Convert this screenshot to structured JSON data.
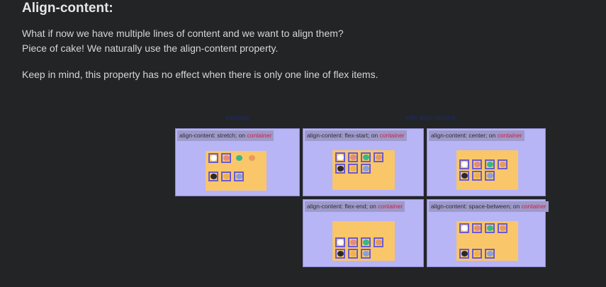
{
  "heading": "Align-content:",
  "intro_line1": "What if now we have multiple lines of content and we want to align them?",
  "intro_line2": "Piece of cake! We naturally use the align-content property.",
  "note": "Keep in mind, this property has no effect when there is only one line of flex items.",
  "faint_labels": [
    "example",
    "with align-content"
  ],
  "on_word": "on",
  "container_word": "container",
  "panels": [
    {
      "code": "align-content: stretch;",
      "variant": "stretch"
    },
    {
      "code": "align-content: flex-start;",
      "variant": "flex-start"
    },
    {
      "code": "align-content: center;",
      "variant": "center"
    },
    {
      "code": "align-content: flex-end;",
      "variant": "flex-end"
    },
    {
      "code": "align-content: space-between;",
      "variant": "space-between"
    }
  ],
  "colors": {
    "background": "#232425",
    "panel": "#b7b5f6",
    "container": "#f9c66a",
    "tile_border": "#6b5bd0",
    "keyword": "#d21a45"
  },
  "animals": [
    {
      "name": "cat-icon",
      "color": "#ffffff"
    },
    {
      "name": "pig-icon",
      "color": "#e38a7e"
    },
    {
      "name": "frog-icon",
      "color": "#35b88a"
    },
    {
      "name": "bear-icon",
      "color": "#e79a5b"
    },
    {
      "name": "panda-icon",
      "color": "#2a2a2a"
    },
    {
      "name": "monkey-icon",
      "color": "#f1b04a"
    },
    {
      "name": "koala-icon",
      "color": "#8aa0d9"
    }
  ]
}
